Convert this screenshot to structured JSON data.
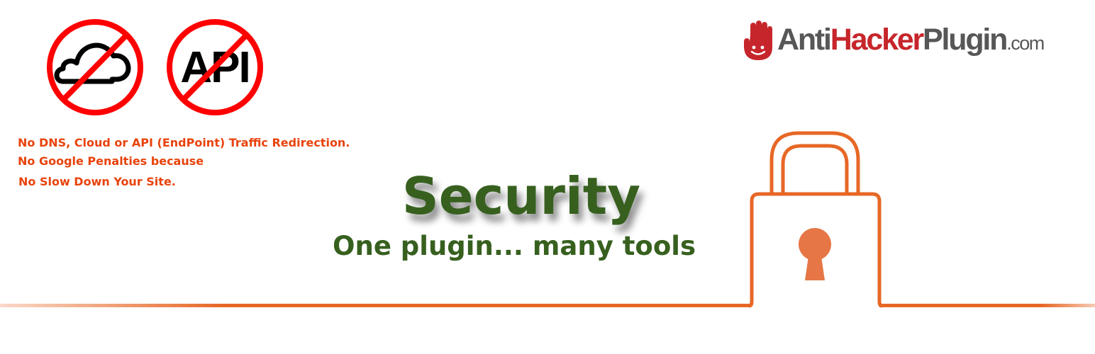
{
  "brand": {
    "logo_part_anti": "Anti",
    "logo_part_hacker": "Hacker",
    "logo_part_plugin": "Plugin",
    "logo_part_tld": ".com",
    "logo_icon": "hand-icon"
  },
  "badges": [
    {
      "icon": "cloud-icon",
      "status": "prohibited"
    },
    {
      "icon": "api-icon",
      "text": "API",
      "status": "prohibited"
    }
  ],
  "notices": [
    "No DNS, Cloud or API (EndPoint) Traffic Redirection.",
    "No Google Penalties because",
    "No Slow Down Your Site."
  ],
  "headline": "Security",
  "tagline": "One plugin... many tools",
  "graphic": {
    "icon": "padlock-icon"
  },
  "colors": {
    "orange_red": "#e8430c",
    "prohibited_red": "#ff0000",
    "green": "#37601f",
    "lock_orange": "#e76726",
    "keyhole": "#e67646",
    "logo_gray": "#575757",
    "logo_red": "#c6262b"
  }
}
